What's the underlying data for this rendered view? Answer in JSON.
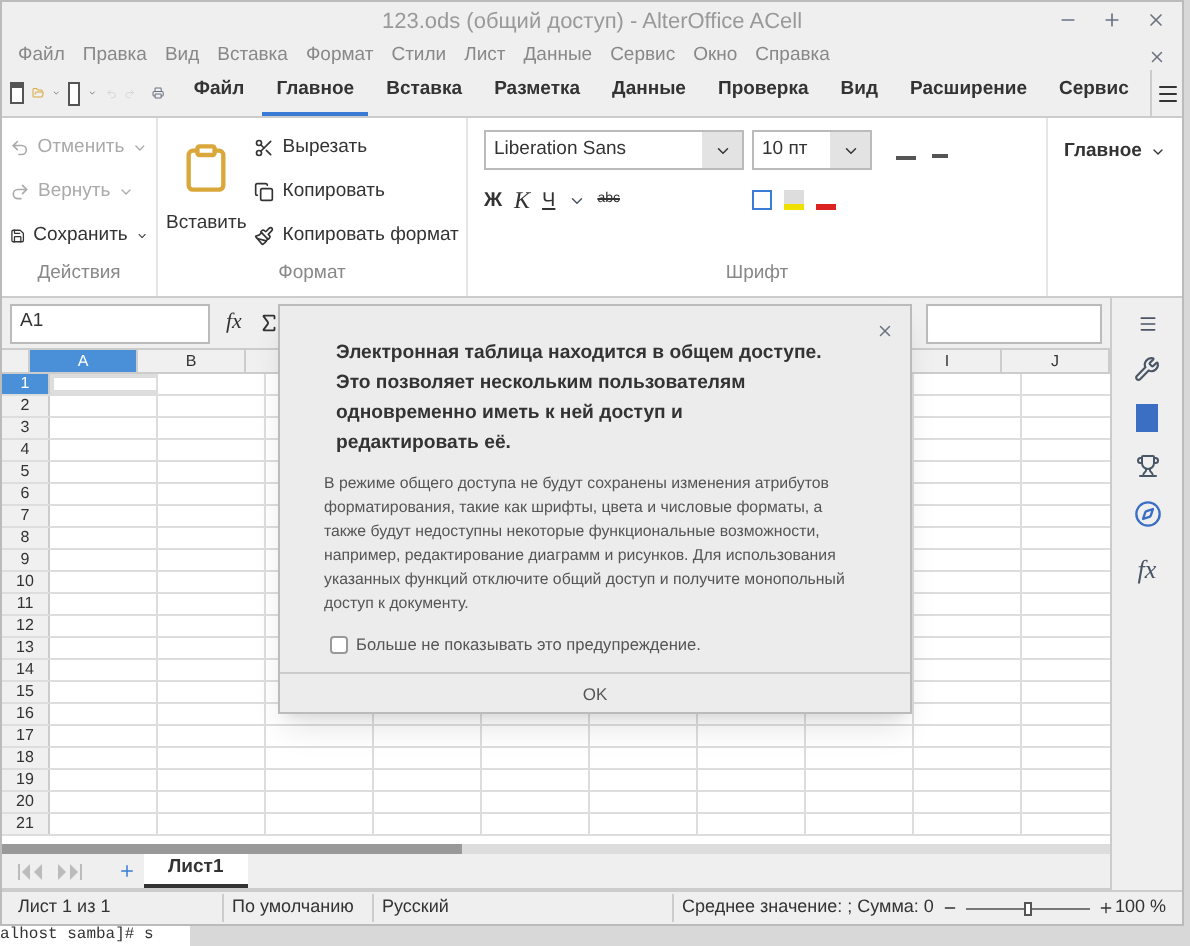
{
  "window": {
    "title": "123.ods (общий доступ) - AlterOffice ACell"
  },
  "menu": [
    "Файл",
    "Правка",
    "Вид",
    "Вставка",
    "Формат",
    "Стили",
    "Лист",
    "Данные",
    "Сервис",
    "Окно",
    "Справка"
  ],
  "tabs": [
    {
      "label": "Файл",
      "selected": false
    },
    {
      "label": "Главное",
      "selected": true
    },
    {
      "label": "Вставка",
      "selected": false
    },
    {
      "label": "Разметка",
      "selected": false
    },
    {
      "label": "Данные",
      "selected": false
    },
    {
      "label": "Проверка",
      "selected": false
    },
    {
      "label": "Вид",
      "selected": false
    },
    {
      "label": "Расширение",
      "selected": false
    },
    {
      "label": "Сервис",
      "selected": false
    }
  ],
  "ribbon": {
    "actions": {
      "label": "Действия",
      "items": [
        {
          "label": "Отменить",
          "disabled": true
        },
        {
          "label": "Вернуть",
          "disabled": true
        },
        {
          "label": "Сохранить",
          "disabled": false
        }
      ]
    },
    "format": {
      "label": "Формат",
      "paste": "Вставить",
      "cut": "Вырезать",
      "copy": "Копировать",
      "clone": "Копировать формат"
    },
    "font": {
      "label": "Шрифт",
      "family": "Liberation Sans",
      "size": "10 пт",
      "bold": "Ж",
      "italic": "К",
      "underline": "Ч",
      "strike": "abc"
    },
    "style": "Главное"
  },
  "formula_bar": {
    "cell": "A1",
    "function_label": "fx"
  },
  "sidebar": {
    "function_label": "fx"
  },
  "grid": {
    "columns": [
      {
        "label": "A",
        "selected": true
      },
      {
        "label": "B",
        "selected": false
      },
      {
        "label": "I",
        "selected": false
      },
      {
        "label": "J",
        "selected": false
      }
    ],
    "rows": [
      {
        "label": "1",
        "selected": true
      },
      {
        "label": "2",
        "selected": false
      },
      {
        "label": "3",
        "selected": false
      },
      {
        "label": "4",
        "selected": false
      },
      {
        "label": "5",
        "selected": false
      },
      {
        "label": "6",
        "selected": false
      },
      {
        "label": "7",
        "selected": false
      },
      {
        "label": "8",
        "selected": false
      },
      {
        "label": "9",
        "selected": false
      },
      {
        "label": "10",
        "selected": false
      },
      {
        "label": "11",
        "selected": false
      },
      {
        "label": "12",
        "selected": false
      },
      {
        "label": "13",
        "selected": false
      },
      {
        "label": "14",
        "selected": false
      },
      {
        "label": "15",
        "selected": false
      },
      {
        "label": "16",
        "selected": false
      },
      {
        "label": "17",
        "selected": false
      },
      {
        "label": "18",
        "selected": false
      },
      {
        "label": "19",
        "selected": false
      },
      {
        "label": "20",
        "selected": false
      },
      {
        "label": "21",
        "selected": false
      }
    ]
  },
  "sheet_tabs": [
    {
      "label": "Лист1",
      "selected": true
    }
  ],
  "status_bar": {
    "sheet": "Лист 1 из 1",
    "page_style": "По умолчанию",
    "language": "Русский",
    "summary": "Среднее значение: ; Сумма: 0",
    "zoom": {
      "level": 0.5
    },
    "zoom_text": "100 %"
  },
  "dialog": {
    "heading": "Электронная таблица находится в общем доступе. Это позволяет нескольким пользователям одновременно иметь к ней доступ и редактировать её.",
    "body": "В режиме общего доступа не будут сохранены изменения атрибутов форматирования, такие как шрифты, цвета и числовые форматы, а также будут недоступны некоторые функциональные возможности, например, редактирование диаграмм и рисунков. Для использования указанных функций отключите общий доступ и получите монопольный доступ к документу.",
    "checkbox": {
      "label": "Больше не показывать это предупреждение.",
      "checked": false
    },
    "ok": "OK"
  },
  "desktop": {
    "terminal": "alhost samba]# s"
  }
}
